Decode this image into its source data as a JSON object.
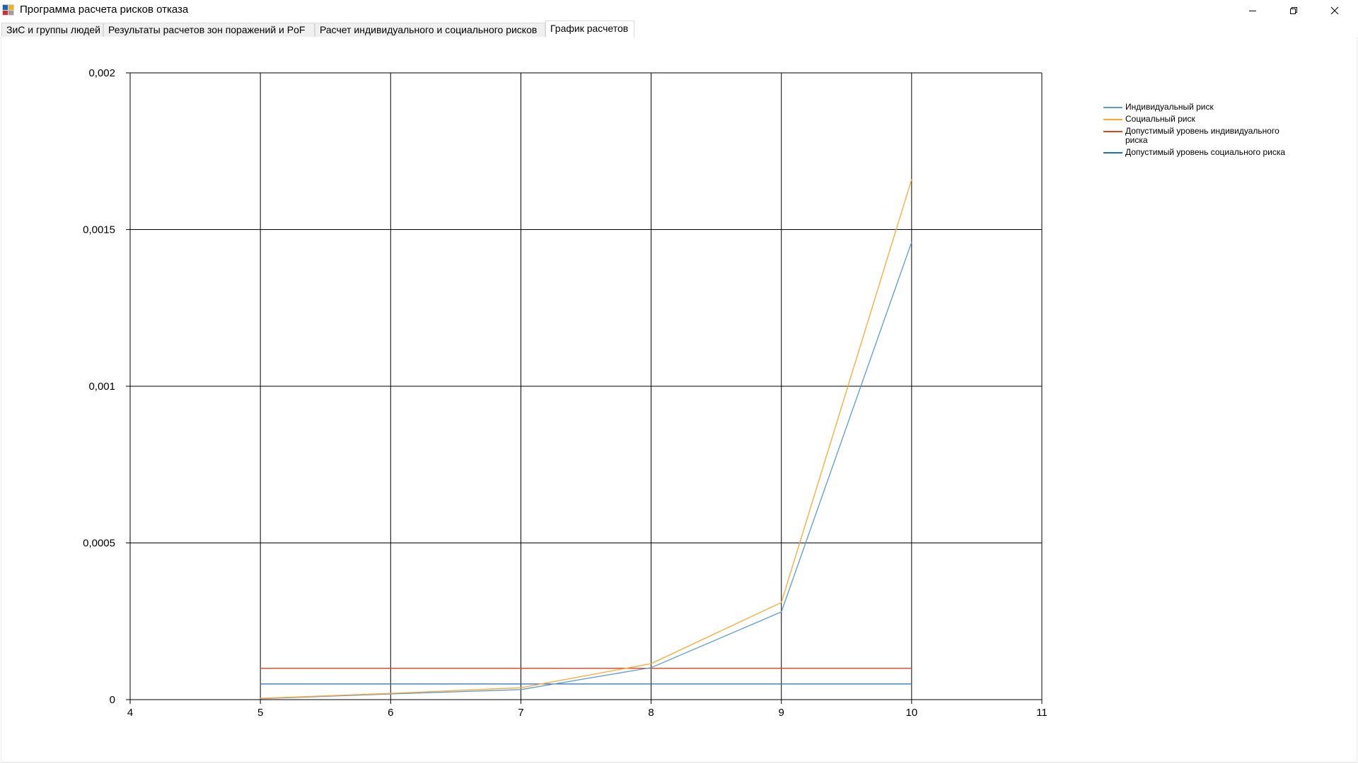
{
  "window": {
    "title": "Программа расчета рисков отказа",
    "icon": "app-icon",
    "controls": [
      "minimize-icon",
      "restore-icon",
      "close-icon"
    ]
  },
  "tabs": [
    {
      "label": "ЗиС и группы людей",
      "active": false
    },
    {
      "label": "Результаты расчетов зон поражений и PoF",
      "active": false
    },
    {
      "label": "Расчет индивидуального и социального рисков",
      "active": false
    },
    {
      "label": "График расчетов",
      "active": true
    }
  ],
  "chart_data": {
    "type": "line",
    "title": "",
    "xlabel": "",
    "ylabel": "",
    "xlim": [
      4,
      11
    ],
    "ylim": [
      0,
      0.002
    ],
    "x_ticks": [
      4,
      5,
      6,
      7,
      8,
      9,
      10,
      11
    ],
    "x_tick_labels": [
      "4",
      "5",
      "6",
      "7",
      "8",
      "9",
      "10",
      "11"
    ],
    "y_ticks": [
      0,
      0.0005,
      0.001,
      0.0015,
      0.002
    ],
    "y_tick_labels": [
      "0",
      "0,0005",
      "0,001",
      "0,0015",
      "0,002"
    ],
    "grid": true,
    "legend_position": "right-top",
    "series": [
      {
        "name": "Индивидуальный риск",
        "color": "#5b9bd5",
        "x": [
          5,
          6,
          7,
          8,
          9,
          10
        ],
        "values": [
          3e-06,
          1.8e-05,
          3.2e-05,
          0.000102,
          0.00028,
          0.00146
        ]
      },
      {
        "name": "Социальный риск",
        "color": "#ffa830",
        "x": [
          5,
          6,
          7,
          8,
          9,
          10
        ],
        "values": [
          4e-06,
          2e-05,
          3.8e-05,
          0.000115,
          0.00031,
          0.00166
        ]
      },
      {
        "name": "Допустимый уровень индивидуального риска",
        "color": "#e8411b",
        "x": [
          5,
          6,
          7,
          8,
          9,
          10
        ],
        "values": [
          0.0001,
          0.0001,
          0.0001,
          0.0001,
          0.0001,
          0.0001
        ]
      },
      {
        "name": "Допустимый уровень социального риска",
        "color": "#1f6fc5",
        "x": [
          5,
          6,
          7,
          8,
          9,
          10
        ],
        "values": [
          5e-05,
          5e-05,
          5e-05,
          5e-05,
          5e-05,
          5e-05
        ]
      }
    ]
  }
}
